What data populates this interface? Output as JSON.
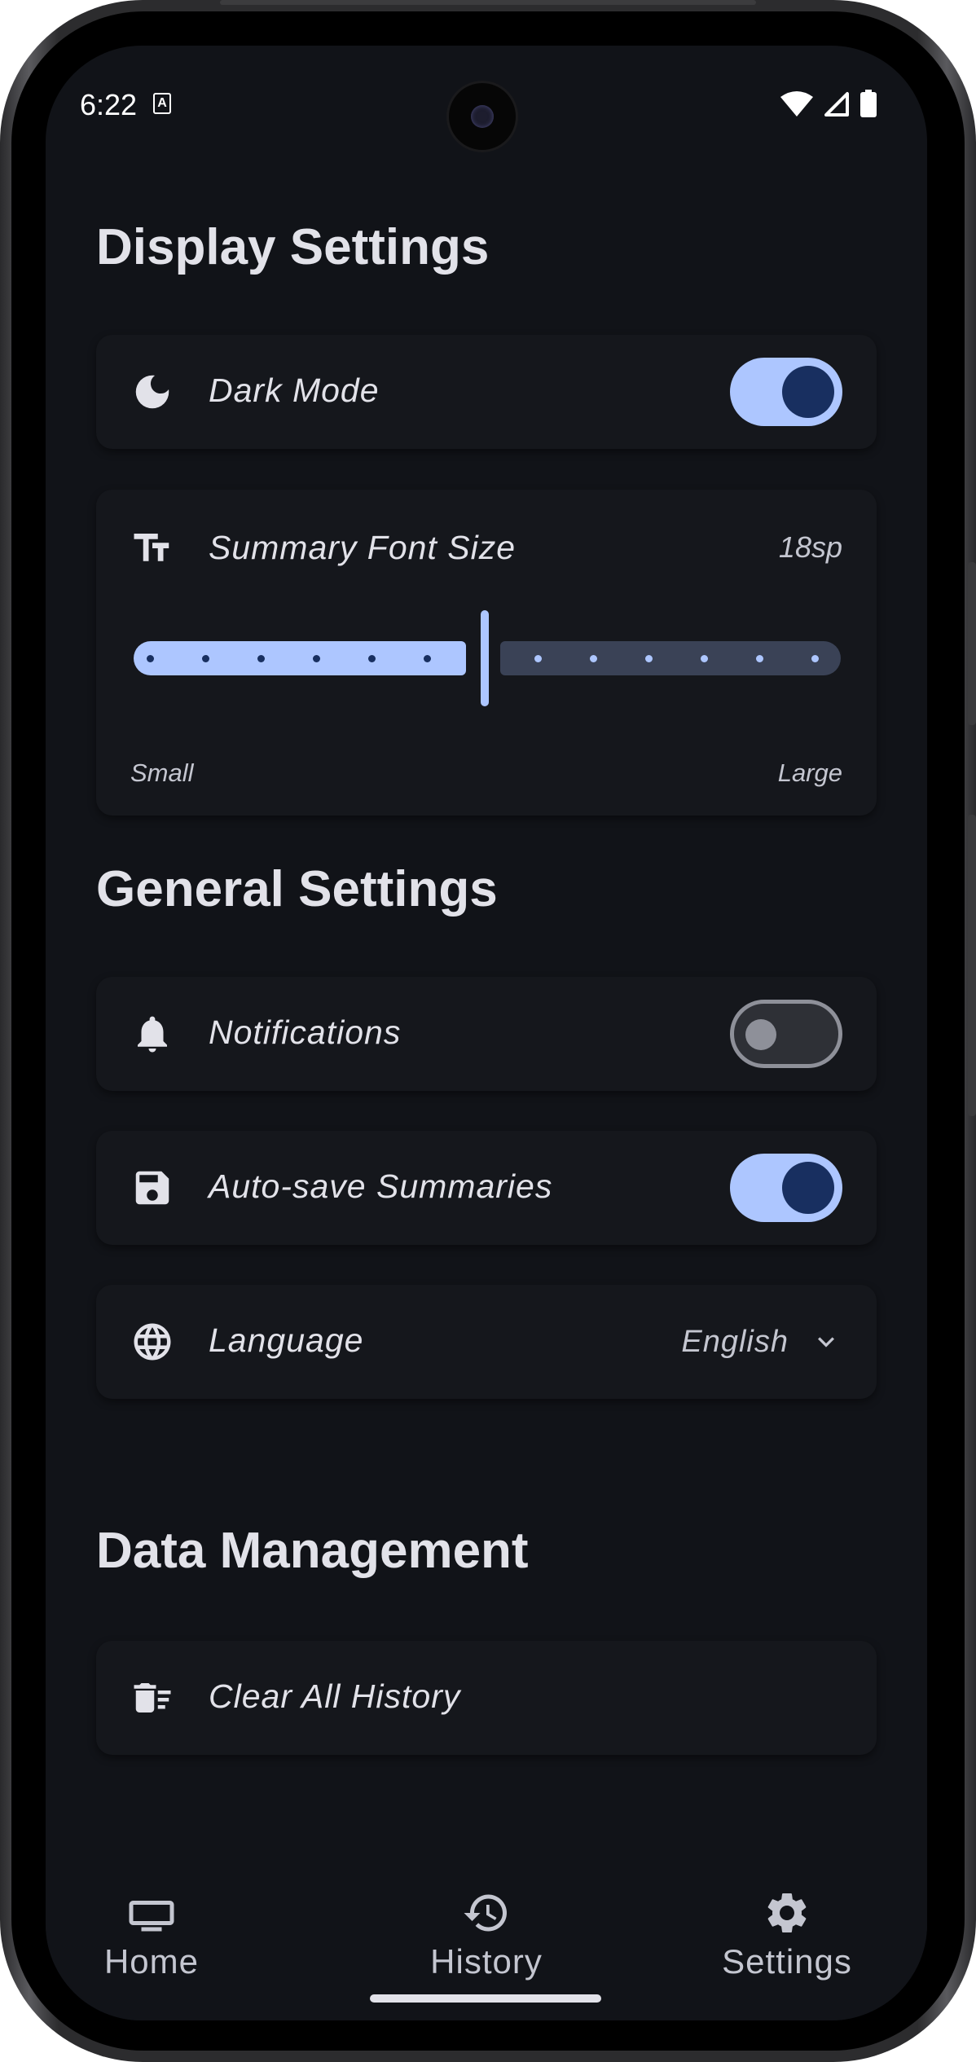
{
  "status_bar": {
    "time": "6:22",
    "icons": [
      "a-icon",
      "wifi-icon",
      "signal-icon",
      "battery-icon"
    ]
  },
  "display_settings": {
    "title": "Display Settings",
    "dark_mode": {
      "label": "Dark Mode",
      "enabled": true,
      "icon": "moon-icon"
    },
    "font_size": {
      "label": "Summary Font Size",
      "value": "18sp",
      "icon": "text-size-icon",
      "min_label": "Small",
      "max_label": "Large",
      "slider_fraction": 0.5
    }
  },
  "general_settings": {
    "title": "General Settings",
    "notifications": {
      "label": "Notifications",
      "enabled": false,
      "icon": "bell-icon"
    },
    "auto_save": {
      "label": "Auto-save Summaries",
      "enabled": true,
      "icon": "save-icon"
    },
    "language": {
      "label": "Language",
      "value": "English",
      "icon": "globe-icon"
    }
  },
  "data_management": {
    "title": "Data Management",
    "clear_history": {
      "label": "Clear All History",
      "icon": "delete-sweep-icon"
    }
  },
  "bottom_nav": {
    "items": [
      {
        "label": "Home",
        "icon": "tv-icon"
      },
      {
        "label": "History",
        "icon": "history-icon"
      },
      {
        "label": "Settings",
        "icon": "gear-icon"
      }
    ],
    "selected": "Settings"
  },
  "colors": {
    "background": "#111318",
    "card": "#15171c",
    "accent": "#adc6ff",
    "accent_dark": "#182f60",
    "text": "#e2e2e9"
  }
}
